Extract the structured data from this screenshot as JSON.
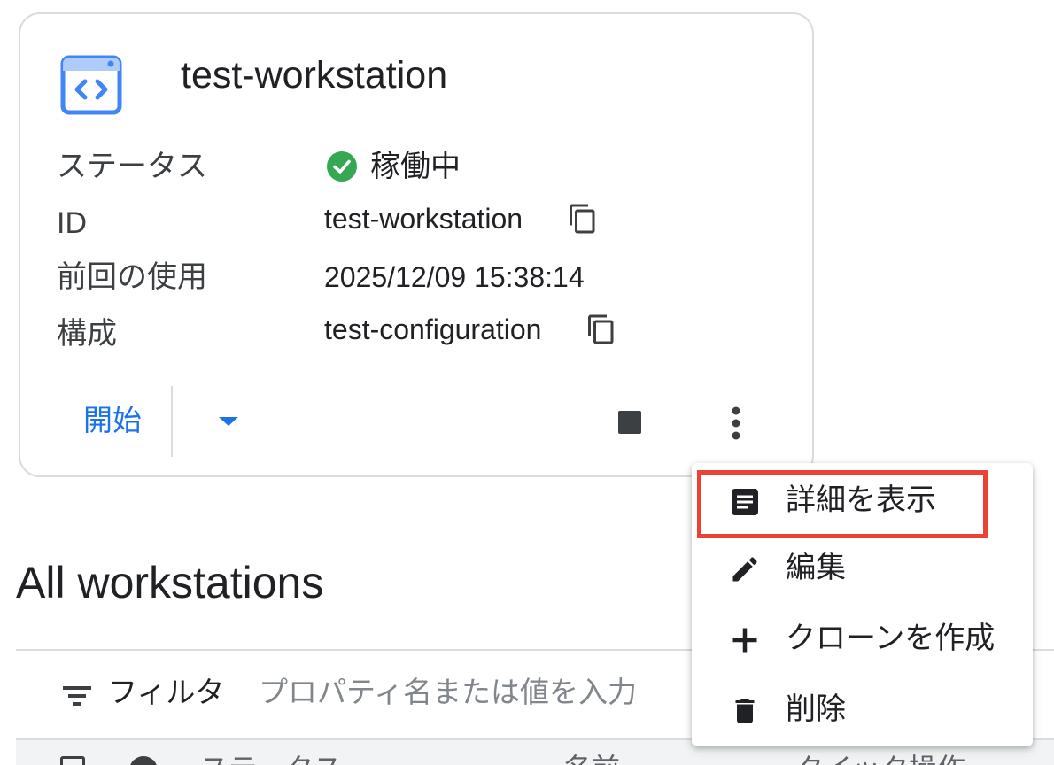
{
  "workstation_card": {
    "title": "test-workstation",
    "rows": [
      {
        "label": "ステータス",
        "value": "稼働中"
      },
      {
        "label": "ID",
        "value": "test-workstation"
      },
      {
        "label": "前回の使用",
        "value": "2025/12/09 15:38:14"
      },
      {
        "label": "構成",
        "value": "test-configuration"
      }
    ],
    "start_label": "開始",
    "status_color": "#34a853",
    "accent_color": "#1a73e8"
  },
  "context_menu": {
    "items": [
      {
        "label": "詳細を表示",
        "icon": "article-icon"
      },
      {
        "label": "編集",
        "icon": "pencil-icon"
      },
      {
        "label": "クローンを作成",
        "icon": "plus-icon"
      },
      {
        "label": "削除",
        "icon": "trash-icon"
      }
    ],
    "highlight_color": "#ea4335"
  },
  "section": {
    "title": "All workstations"
  },
  "filter": {
    "label": "フィルタ",
    "placeholder": "プロパティ名または値を入力"
  },
  "table": {
    "headers": [
      "ステータス",
      "名前",
      "クイック操作"
    ]
  }
}
